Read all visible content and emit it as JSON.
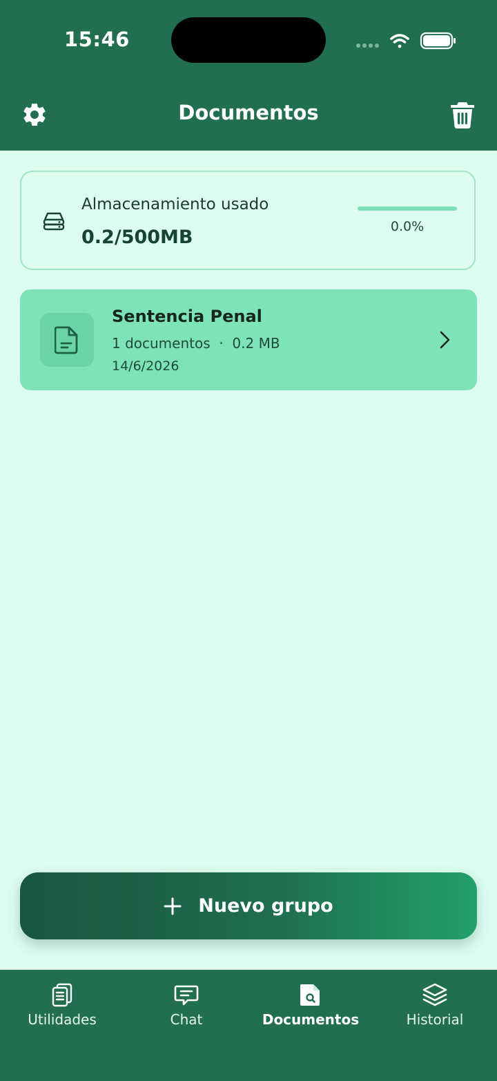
{
  "status_bar": {
    "time": "15:46"
  },
  "header": {
    "title": "Documentos"
  },
  "storage": {
    "label": "Almacenamiento usado",
    "value": "0.2/500MB",
    "percent_text": "0.0%",
    "progress": 0.0
  },
  "groups": [
    {
      "name": "Sentencia Penal",
      "meta": "1 documentos  ·  0.2 MB",
      "date": "14/6/2026"
    }
  ],
  "new_group_button": {
    "label": "Nuevo grupo"
  },
  "tabs": [
    {
      "label": "Utilidades",
      "icon": "clipboard-list-icon",
      "active": false
    },
    {
      "label": "Chat",
      "icon": "chat-icon",
      "active": false
    },
    {
      "label": "Documentos",
      "icon": "file-search-icon",
      "active": true
    },
    {
      "label": "Historial",
      "icon": "layers-icon",
      "active": false
    }
  ],
  "colors": {
    "primary": "#226e50",
    "background": "#dcfdf0",
    "card": "#7ee3b8",
    "accent": "#7ddfb8"
  }
}
